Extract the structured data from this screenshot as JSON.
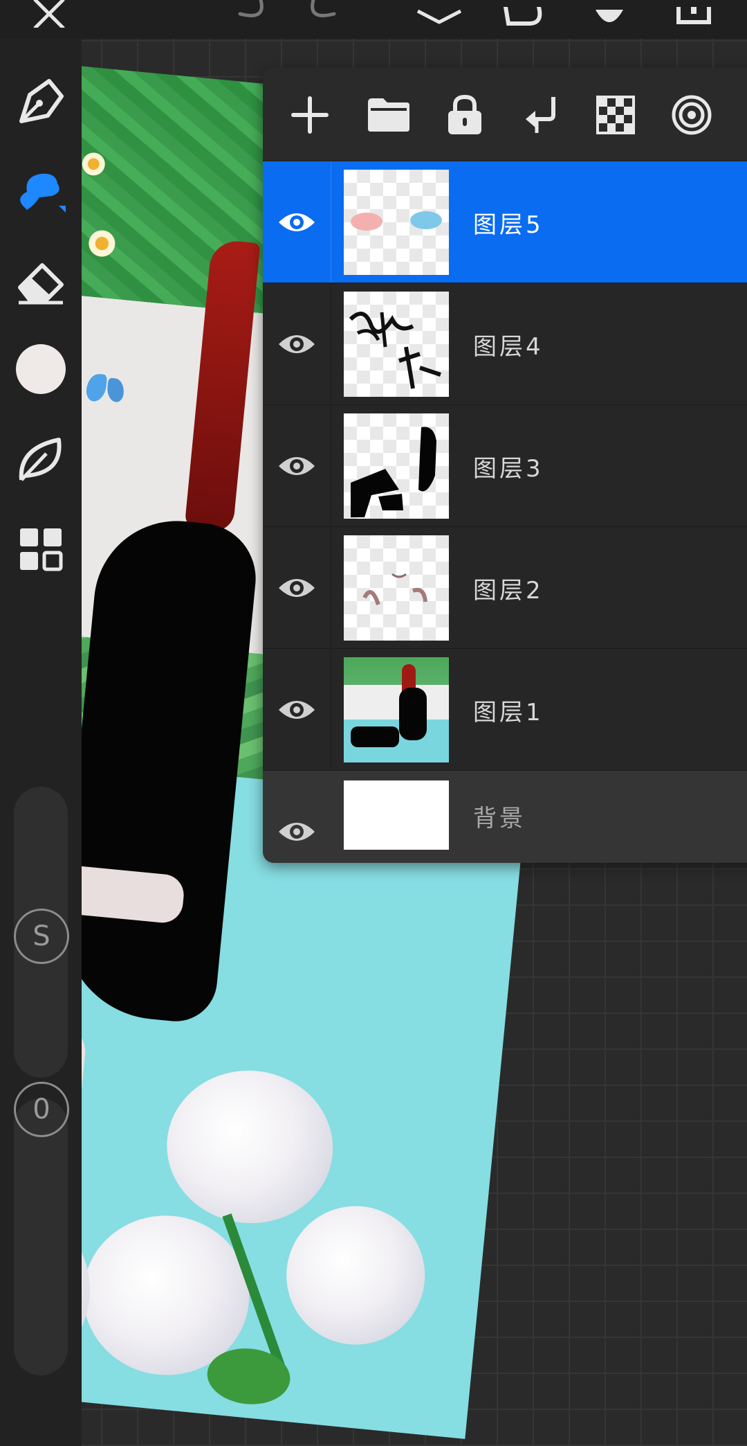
{
  "app": {
    "name": "drawing-canvas"
  },
  "topbar": {
    "buttons": [
      {
        "name": "close-icon",
        "glyph": "✕"
      },
      {
        "name": "undo-icon",
        "glyph": "↶"
      },
      {
        "name": "redo-icon",
        "glyph": "↷"
      },
      {
        "name": "layers-icon",
        "glyph": "⧉"
      },
      {
        "name": "transform-icon",
        "glyph": "⟳"
      },
      {
        "name": "settings-icon",
        "glyph": "⚙"
      },
      {
        "name": "export-icon",
        "glyph": "⬆"
      }
    ]
  },
  "sidebar": {
    "tools": [
      {
        "name": "pen-tool-icon"
      },
      {
        "name": "smudge-brush-icon",
        "active": true
      },
      {
        "name": "eraser-icon"
      },
      {
        "name": "color-swatch",
        "color": "#efe9e7"
      },
      {
        "name": "leaf-brush-icon"
      },
      {
        "name": "gallery-grid-icon"
      }
    ],
    "size_badge": "S",
    "opacity_badge": "0"
  },
  "layers_panel": {
    "toolbar": [
      {
        "name": "add-layer-icon"
      },
      {
        "name": "folder-icon"
      },
      {
        "name": "lock-icon"
      },
      {
        "name": "merge-down-icon"
      },
      {
        "name": "checkerboard-icon"
      },
      {
        "name": "target-icon"
      }
    ],
    "layers": [
      {
        "name": "图层5",
        "visible": true,
        "selected": true,
        "thumb": "blush"
      },
      {
        "name": "图层4",
        "visible": true,
        "selected": false,
        "thumb": "signature"
      },
      {
        "name": "图层3",
        "visible": true,
        "selected": false,
        "thumb": "silhouette"
      },
      {
        "name": "图层2",
        "visible": true,
        "selected": false,
        "thumb": "sketch"
      },
      {
        "name": "图层1",
        "visible": true,
        "selected": false,
        "thumb": "photo"
      },
      {
        "name": "背景",
        "visible": true,
        "selected": false,
        "thumb": "white"
      }
    ]
  },
  "colors": {
    "accent": "#0a6cf0",
    "active_tool": "#1e88ff",
    "panel_bg": "#2a2a2a",
    "sidebar_bg": "#222222"
  }
}
